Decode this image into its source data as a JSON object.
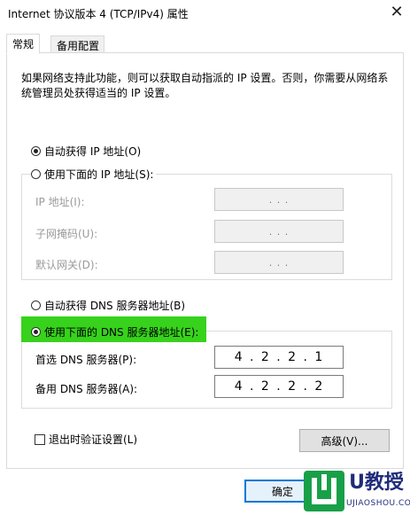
{
  "window": {
    "title": "Internet 协议版本 4 (TCP/IPv4) 属性",
    "close_glyph": "✕"
  },
  "tabs": [
    {
      "label": "常规",
      "active": true
    },
    {
      "label": "备用配置",
      "active": false
    }
  ],
  "description": "如果网络支持此功能，则可以获取自动指派的 IP 设置。否则，你需要从网络系统管理员处获得适当的 IP 设置。",
  "ip_section": {
    "auto_label": "自动获得 IP 地址(O)",
    "auto_checked": true,
    "manual_label": "使用下面的 IP 地址(S):",
    "manual_checked": false,
    "fields": [
      {
        "label": "IP 地址(I):",
        "value": ".   .   ."
      },
      {
        "label": "子网掩码(U):",
        "value": ".   .   ."
      },
      {
        "label": "默认网关(D):",
        "value": ".   .   ."
      }
    ]
  },
  "dns_section": {
    "auto_label": "自动获得 DNS 服务器地址(B)",
    "auto_checked": false,
    "manual_label": "使用下面的 DNS 服务器地址(E):",
    "manual_checked": true,
    "highlight_color": "#37d21c",
    "preferred": {
      "label": "首选 DNS 服务器(P):",
      "octets": [
        "4",
        "2",
        "2",
        "1"
      ]
    },
    "alternate": {
      "label": "备用 DNS 服务器(A):",
      "octets": [
        "4",
        "2",
        "2",
        "2"
      ]
    }
  },
  "validate_label": "退出时验证设置(L)",
  "validate_checked": false,
  "advanced_button": "高级(V)...",
  "ok_button": "确定",
  "watermark": {
    "brand": "U教授",
    "sub": "UJIAOSHOU.COM"
  },
  "colors": {
    "ok_border": "#0078d7",
    "logo_green": "#18a048",
    "logo_blue": "#1f2b7a"
  }
}
